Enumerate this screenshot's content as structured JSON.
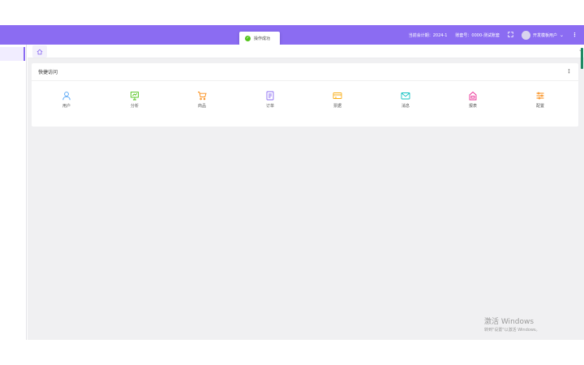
{
  "header": {
    "fiscal_period": "当前会计期：2024-1",
    "account_set": "账套号：0000-测试账套",
    "username": "开发模板用户",
    "colors": {
      "bar": "#8b6cf2"
    }
  },
  "toast": {
    "message": "操作成功",
    "icon": "check-circle-icon"
  },
  "quick_access": {
    "title": "快捷访问",
    "items": [
      {
        "label": "用户",
        "icon": "user-icon",
        "color": "#4a9ff5"
      },
      {
        "label": "分析",
        "icon": "presentation-icon",
        "color": "#52c41a"
      },
      {
        "label": "商品",
        "icon": "cart-icon",
        "color": "#fa8c16"
      },
      {
        "label": "订单",
        "icon": "document-icon",
        "color": "#8b6cf2"
      },
      {
        "label": "票据",
        "icon": "card-icon",
        "color": "#faad14"
      },
      {
        "label": "消息",
        "icon": "mail-icon",
        "color": "#13c2c2"
      },
      {
        "label": "报表",
        "icon": "report-icon",
        "color": "#eb2f96"
      },
      {
        "label": "配置",
        "icon": "settings-sliders-icon",
        "color": "#fa8c16"
      }
    ]
  },
  "watermark": {
    "title": "激活 Windows",
    "subtitle": "转到\"设置\"以激活 Windows。"
  }
}
